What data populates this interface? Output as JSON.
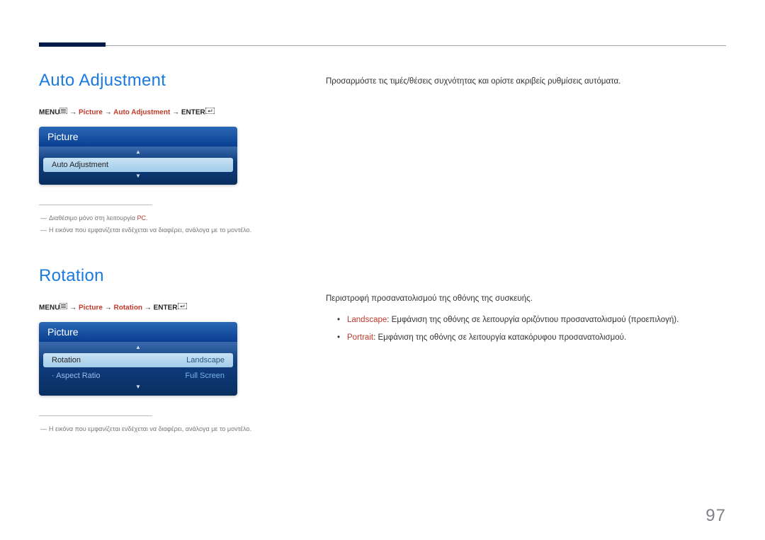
{
  "page_number": "97",
  "section1": {
    "title": "Auto Adjustment",
    "breadcrumb": {
      "menu": "MENU",
      "arrow": "→",
      "picture": "Picture",
      "item": "Auto Adjustment",
      "enter": "ENTER"
    },
    "osd": {
      "header": "Picture",
      "row1_label": "Auto Adjustment"
    },
    "footnote1_prefix": "Διαθέσιμο μόνο στη λειτουργία ",
    "footnote1_hl": "PC",
    "footnote1_suffix": ".",
    "footnote2": "Η εικόνα που εμφανίζεται ενδέχεται να διαφέρει, ανάλογα με το μοντέλο.",
    "description": "Προσαρμόστε τις τιμές/θέσεις συχνότητας και ορίστε ακριβείς ρυθμίσεις αυτόματα."
  },
  "section2": {
    "title": "Rotation",
    "breadcrumb": {
      "menu": "MENU",
      "arrow": "→",
      "picture": "Picture",
      "item": "Rotation",
      "enter": "ENTER"
    },
    "osd": {
      "header": "Picture",
      "row1_label": "Rotation",
      "row1_value": "Landscape",
      "row2_label": "Aspect Ratio",
      "row2_value": "Full Screen"
    },
    "footnote": "Η εικόνα που εμφανίζεται ενδέχεται να διαφέρει, ανάλογα με το μοντέλο.",
    "description": "Περιστροφή προσανατολισμού της οθόνης της συσκευής.",
    "bullets": [
      {
        "hl": "Landscape",
        "text": ": Εμφάνιση της οθόνης σε λειτουργία οριζόντιου προσανατολισμού (προεπιλογή)."
      },
      {
        "hl": "Portrait",
        "text": ": Εμφάνιση της οθόνης σε λειτουργία κατακόρυφου προσανατολισμού."
      }
    ]
  }
}
